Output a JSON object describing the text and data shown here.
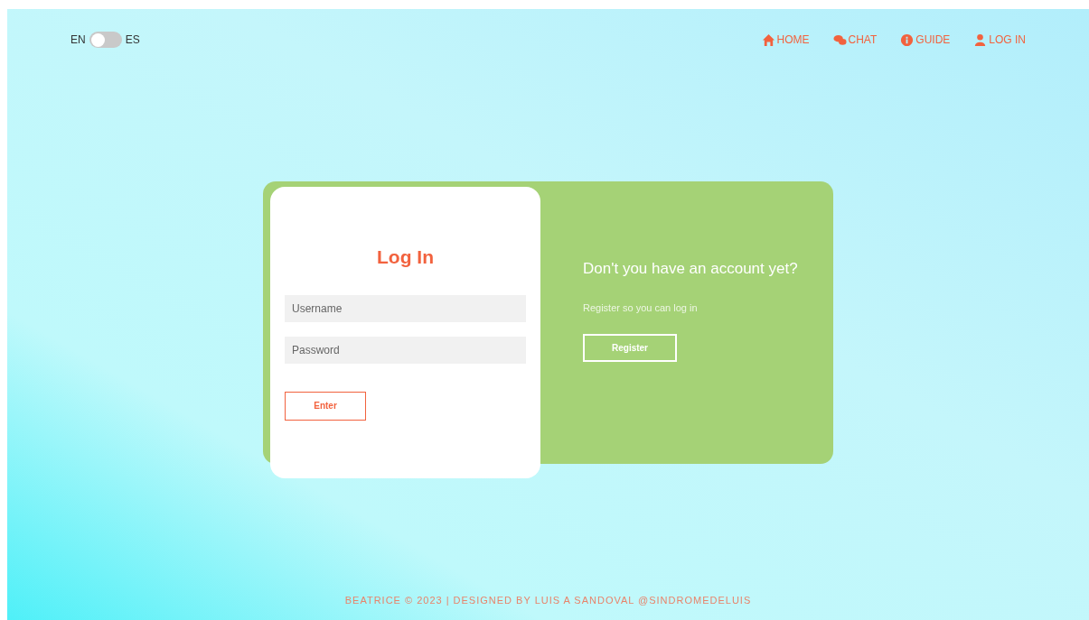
{
  "language_toggle": {
    "left_label": "EN",
    "right_label": "ES",
    "on": false
  },
  "nav": [
    {
      "kind": "home",
      "label": "HOME"
    },
    {
      "kind": "chat",
      "label": "CHAT"
    },
    {
      "kind": "guide",
      "label": "GUIDE"
    },
    {
      "kind": "user",
      "label": "LOG IN"
    }
  ],
  "login": {
    "title": "Log In",
    "username": {
      "placeholder": "Username"
    },
    "password": {
      "placeholder": "Password"
    },
    "button": "Enter"
  },
  "register": {
    "heading": "Don't you have an account yet?",
    "text": "Register so you can log in",
    "button": "Register"
  },
  "footer": "BEATRICE © 2023 | DESIGNED BY LUIS A SANDOVAL @SINDROMEDELUIS"
}
